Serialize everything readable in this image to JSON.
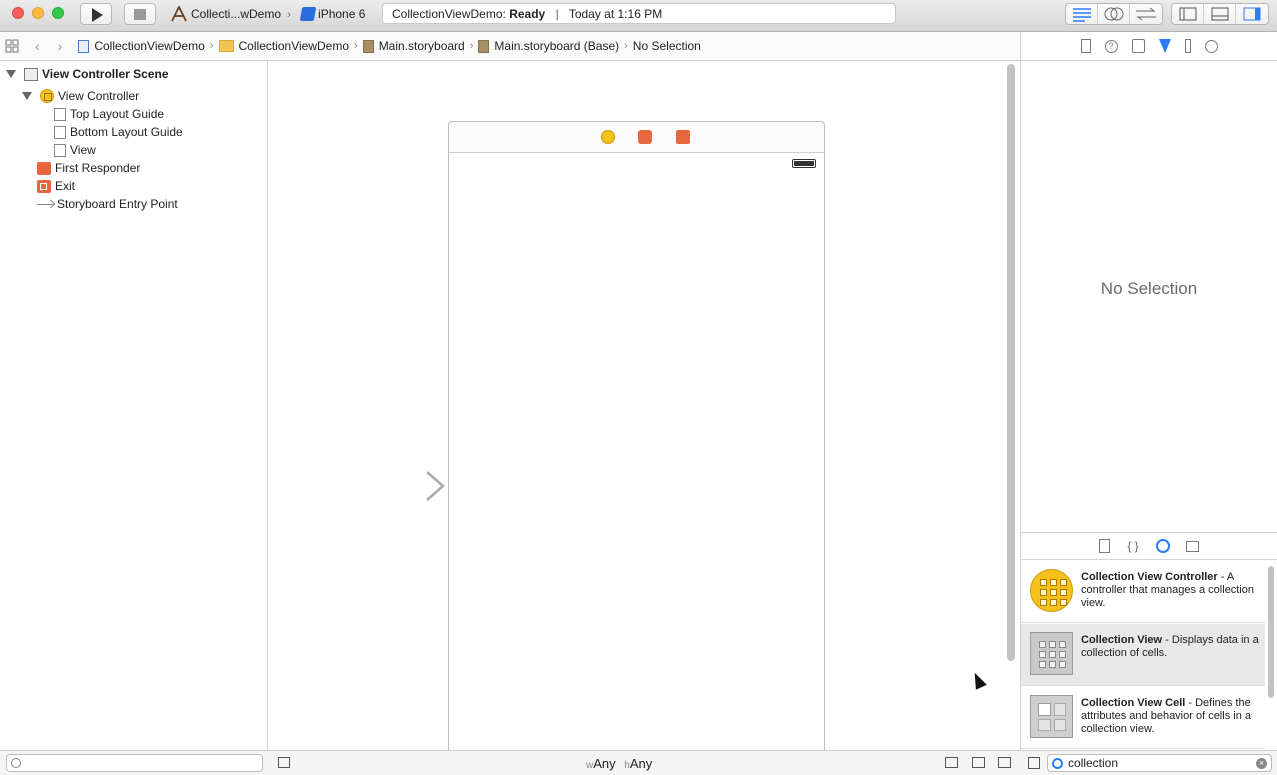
{
  "toolbar": {
    "scheme_name": "Collecti...wDemo",
    "device": "iPhone 6",
    "status_project": "CollectionViewDemo:",
    "status_state": "Ready",
    "status_time": "Today at 1:16 PM"
  },
  "jumpbar": {
    "items": [
      "CollectionViewDemo",
      "CollectionViewDemo",
      "Main.storyboard",
      "Main.storyboard (Base)",
      "No Selection"
    ]
  },
  "outline": {
    "scene": "View Controller Scene",
    "view_controller": "View Controller",
    "top_layout": "Top Layout Guide",
    "bottom_layout": "Bottom Layout Guide",
    "view": "View",
    "first_responder": "First Responder",
    "exit": "Exit",
    "entry_point": "Storyboard Entry Point"
  },
  "inspector": {
    "empty_text": "No Selection"
  },
  "library": {
    "items": [
      {
        "title": "Collection View Controller",
        "desc": " - A controller that manages a collection view."
      },
      {
        "title": "Collection View",
        "desc": " - Displays data in a collection of cells."
      },
      {
        "title": "Collection View Cell",
        "desc": " - Defines the attributes and behavior of cells in a collection view."
      }
    ],
    "search_value": "collection"
  },
  "size_class": {
    "w_prefix": "w",
    "w_value": "Any",
    "h_prefix": "h",
    "h_value": "Any"
  }
}
